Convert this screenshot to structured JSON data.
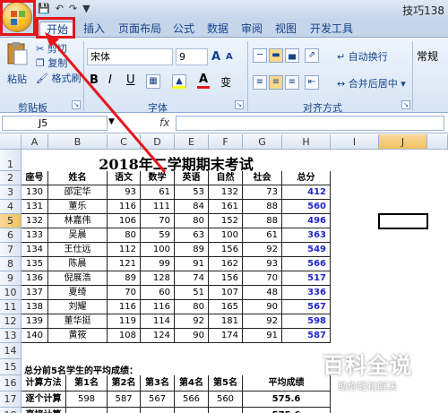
{
  "title_right": "技巧138",
  "tabs": [
    "开始",
    "插入",
    "页面布局",
    "公式",
    "数据",
    "审阅",
    "视图",
    "开发工具"
  ],
  "ribbon": {
    "paste": "粘贴",
    "cut": "剪切",
    "copy": "复制",
    "format_painter": "格式刷",
    "clipboard": "剪贴板",
    "font_name": "宋体",
    "font_size": "9",
    "font_group": "字体",
    "wrap_text": "自动换行",
    "merge_center": "合并后居中",
    "alignment_group": "对齐方式",
    "number_format": "常规",
    "bold_glyph": "B",
    "italic_glyph": "I",
    "underline_glyph": "U",
    "grow_font": "A",
    "shrink_font": "A",
    "font_color_glyph": "A",
    "phonetic_glyph": "变"
  },
  "formula_bar": {
    "name_box": "J5",
    "fx": "fx",
    "content": ""
  },
  "columns": [
    "A",
    "B",
    "C",
    "D",
    "E",
    "F",
    "G",
    "H",
    "I",
    "J"
  ],
  "sheet_title": "2018年二学期期末考试",
  "headers": [
    "座号",
    "姓名",
    "语文",
    "数学",
    "英语",
    "自然",
    "社会",
    "总分"
  ],
  "rows": [
    [
      "130",
      "邵定华",
      "93",
      "61",
      "53",
      "132",
      "73",
      "412"
    ],
    [
      "131",
      "董乐",
      "116",
      "111",
      "84",
      "161",
      "88",
      "560"
    ],
    [
      "132",
      "林嘉伟",
      "106",
      "70",
      "80",
      "152",
      "88",
      "496"
    ],
    [
      "133",
      "吴晨",
      "80",
      "59",
      "63",
      "100",
      "61",
      "363"
    ],
    [
      "134",
      "王仕远",
      "112",
      "100",
      "89",
      "156",
      "92",
      "549"
    ],
    [
      "135",
      "陈晨",
      "121",
      "99",
      "91",
      "162",
      "93",
      "566"
    ],
    [
      "136",
      "倪展浩",
      "89",
      "128",
      "74",
      "156",
      "70",
      "517"
    ],
    [
      "137",
      "夏绮",
      "70",
      "60",
      "51",
      "107",
      "48",
      "336"
    ],
    [
      "138",
      "刘耀",
      "116",
      "116",
      "80",
      "165",
      "90",
      "567"
    ],
    [
      "139",
      "董华挺",
      "119",
      "114",
      "92",
      "181",
      "92",
      "598"
    ],
    [
      "140",
      "黄筱",
      "108",
      "124",
      "90",
      "174",
      "91",
      "587"
    ]
  ],
  "row_numbers": [
    "1",
    "2",
    "3",
    "4",
    "5",
    "6",
    "7",
    "8",
    "9",
    "10",
    "11",
    "12",
    "13",
    "14",
    "15",
    "16",
    "17",
    "18"
  ],
  "avg_title": "总分前5名学生的平均成绩：",
  "avg_headers": [
    "计算方法",
    "第1名",
    "第2名",
    "第3名",
    "第4名",
    "第5名",
    "平均成绩"
  ],
  "avg_row1": [
    "逐个计算",
    "598",
    "587",
    "567",
    "566",
    "560",
    "575.6"
  ],
  "avg_row2": [
    "直接计算",
    "",
    "",
    "",
    "",
    "",
    "575.6"
  ],
  "watermark": {
    "big": "百科全说",
    "small": "助你轻松解决"
  },
  "colors": {
    "highlight": "#e8141b",
    "total_blue": "#1f27c9"
  }
}
